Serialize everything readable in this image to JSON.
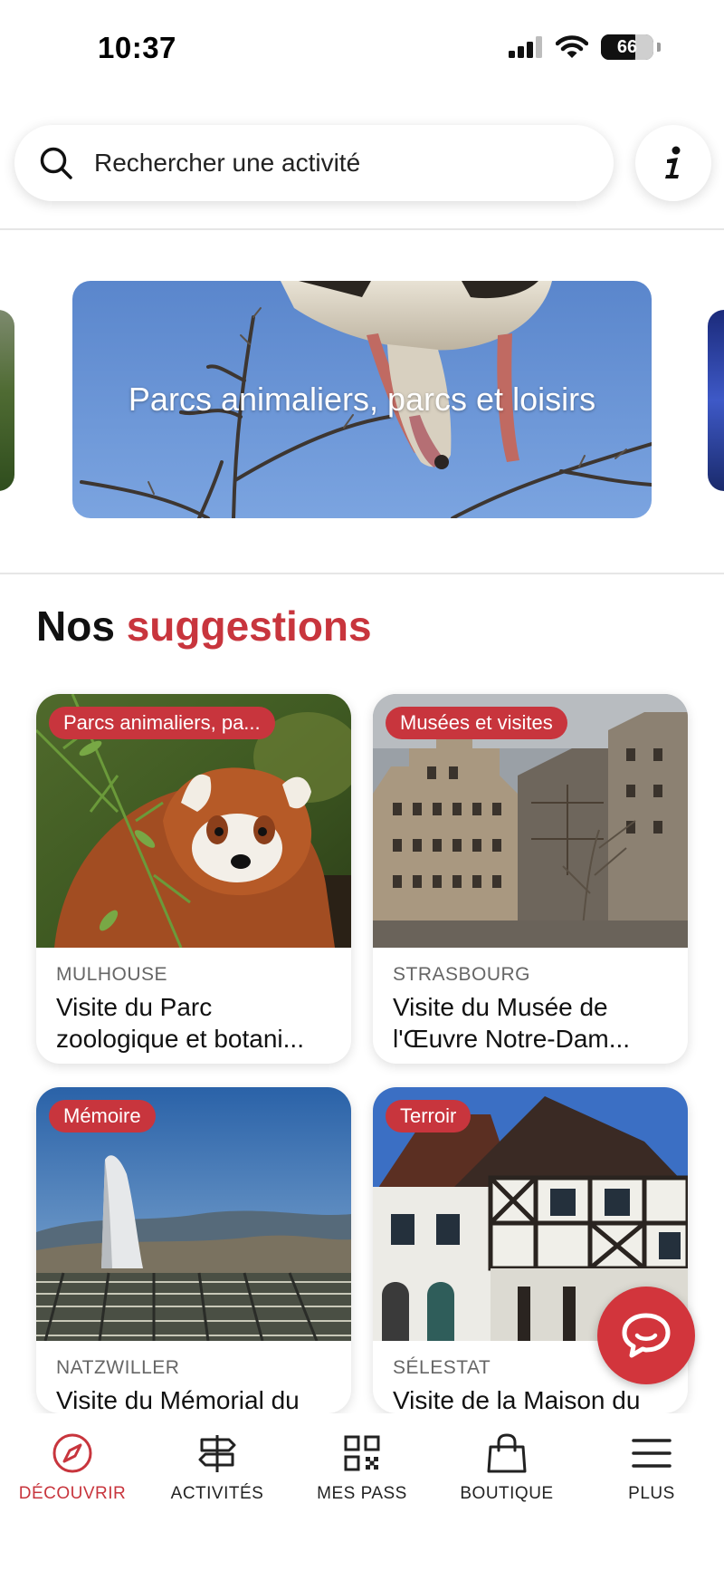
{
  "status_bar": {
    "time": "10:37",
    "battery": "66"
  },
  "search": {
    "placeholder": "Rechercher une activité",
    "icon": "search-icon"
  },
  "info_button": {
    "icon": "info-icon"
  },
  "carousel": {
    "slides": [
      {
        "title": "Parcs animaliers, parcs et loisirs"
      }
    ]
  },
  "suggestions": {
    "title_prefix": "Nos",
    "title_accent": "suggestions",
    "cards": [
      {
        "badge": "Parcs animaliers, pa...",
        "city": "MULHOUSE",
        "title": "Visite du Parc zoologique et botani..."
      },
      {
        "badge": "Musées et visites",
        "city": "STRASBOURG",
        "title": "Visite du Musée de l'Œuvre  Notre-Dam..."
      },
      {
        "badge": "Mémoire",
        "city": "NATZWILLER",
        "title": "Visite du Mémorial du"
      },
      {
        "badge": "Terroir",
        "city": "SÉLESTAT",
        "title": "Visite de la Maison du"
      }
    ]
  },
  "tab_bar": {
    "items": [
      {
        "label": "DÉCOUVRIR",
        "icon": "compass-icon",
        "active": true
      },
      {
        "label": "ACTIVITÉS",
        "icon": "signpost-icon",
        "active": false
      },
      {
        "label": "MES PASS",
        "icon": "qr-code-icon",
        "active": false
      },
      {
        "label": "BOUTIQUE",
        "icon": "shopping-bag-icon",
        "active": false
      },
      {
        "label": "PLUS",
        "icon": "menu-icon",
        "active": false
      }
    ]
  },
  "colors": {
    "accent": "#c8353d",
    "text": "#111111",
    "muted": "#666666"
  }
}
